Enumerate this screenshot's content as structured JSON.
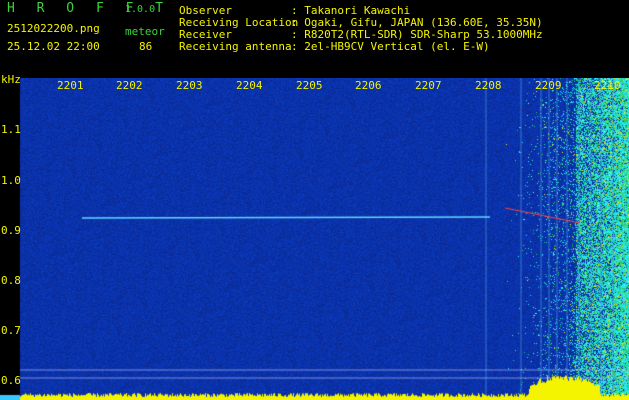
{
  "header": {
    "app_name": "H R O F F T",
    "version": "1.0.0",
    "filename": "2512022200.png",
    "datetime": "25.12.02 22:00",
    "count_label": "meteor",
    "count_value": "86",
    "info_rows": [
      {
        "label": "Observer",
        "value": ": Takanori Kawachi"
      },
      {
        "label": "Receiving Location",
        "value": ": Ogaki, Gifu, JAPAN (136.60E, 35.35N)"
      },
      {
        "label": "Receiver",
        "value": ": R820T2(RTL-SDR) SDR-Sharp 53.1000MHz"
      },
      {
        "label": "Receiving antenna",
        "value": ": 2el-HB9CV Vertical (el. E-W)"
      }
    ]
  },
  "axis": {
    "y_unit": "kHz",
    "x_ticks": [
      "2201",
      "2202",
      "2203",
      "2204",
      "2205",
      "2206",
      "2207",
      "2208",
      "2209",
      "2210"
    ],
    "y_ticks": [
      "1.1",
      "1.0",
      "0.9",
      "0.8",
      "0.7",
      "0.6"
    ]
  },
  "colors": {
    "background_noise": "#0a1a6e",
    "text_green": "#3cd23c",
    "text_yellow": "#f4f400",
    "carrier_line": "#5fd8ff",
    "meteor_trace": "#ff4040"
  }
}
